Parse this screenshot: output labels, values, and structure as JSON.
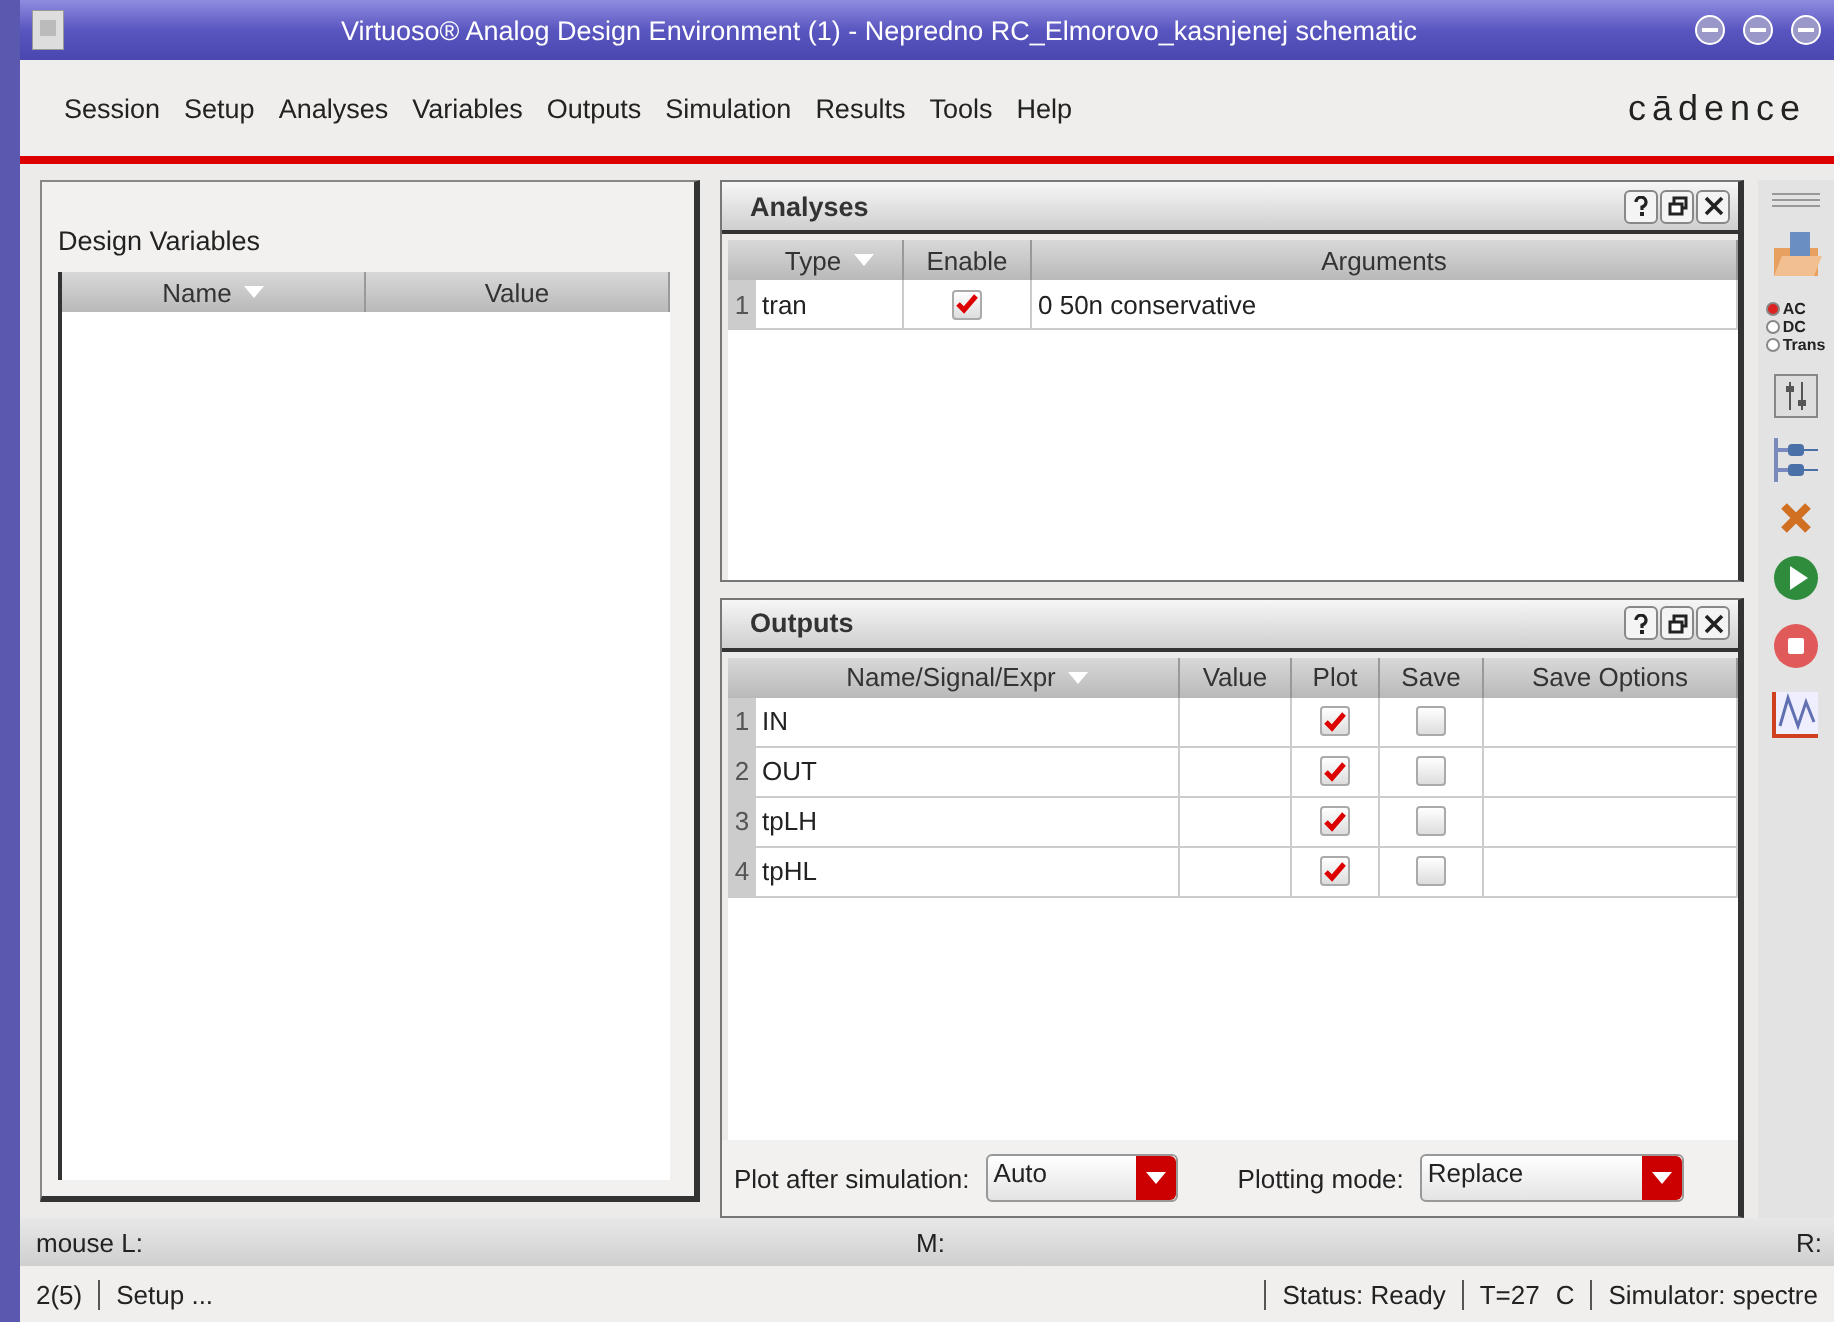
{
  "window": {
    "title": "Virtuoso® Analog Design Environment (1) - Nepredno RC_Elmorovo_kasnjenej schematic"
  },
  "menu": [
    "Session",
    "Setup",
    "Analyses",
    "Variables",
    "Outputs",
    "Simulation",
    "Results",
    "Tools",
    "Help"
  ],
  "brand": "cādence",
  "design_variables": {
    "title": "Design Variables",
    "columns": [
      "Name",
      "Value"
    ]
  },
  "analyses": {
    "title": "Analyses",
    "columns": [
      "Type",
      "Enable",
      "Arguments"
    ],
    "rows": [
      {
        "index": "1",
        "type": "tran",
        "enabled": true,
        "arguments": "0 50n conservative"
      }
    ]
  },
  "outputs": {
    "title": "Outputs",
    "columns": [
      "Name/Signal/Expr",
      "Value",
      "Plot",
      "Save",
      "Save Options"
    ],
    "rows": [
      {
        "index": "1",
        "name": "IN",
        "plot": true,
        "save": false
      },
      {
        "index": "2",
        "name": "OUT",
        "plot": true,
        "save": false
      },
      {
        "index": "3",
        "name": "tpLH",
        "plot": true,
        "save": false
      },
      {
        "index": "4",
        "name": "tpHL",
        "plot": true,
        "save": false
      }
    ]
  },
  "plot_after": {
    "label": "Plot after simulation:",
    "value": "Auto"
  },
  "plotting_mode": {
    "label": "Plotting mode:",
    "value": "Replace"
  },
  "analysis_radios": [
    {
      "label": "AC",
      "selected": true
    },
    {
      "label": "DC",
      "selected": false
    },
    {
      "label": "Trans",
      "selected": false
    }
  ],
  "mouse_bar": {
    "left": "mouse L:",
    "middle": "M:",
    "right": "R:"
  },
  "status_bar": {
    "count": "2(5)",
    "message": "Setup ...",
    "status": "Status: Ready",
    "temperature": "T=27",
    "unit": "C",
    "simulator": "Simulator: spectre"
  }
}
